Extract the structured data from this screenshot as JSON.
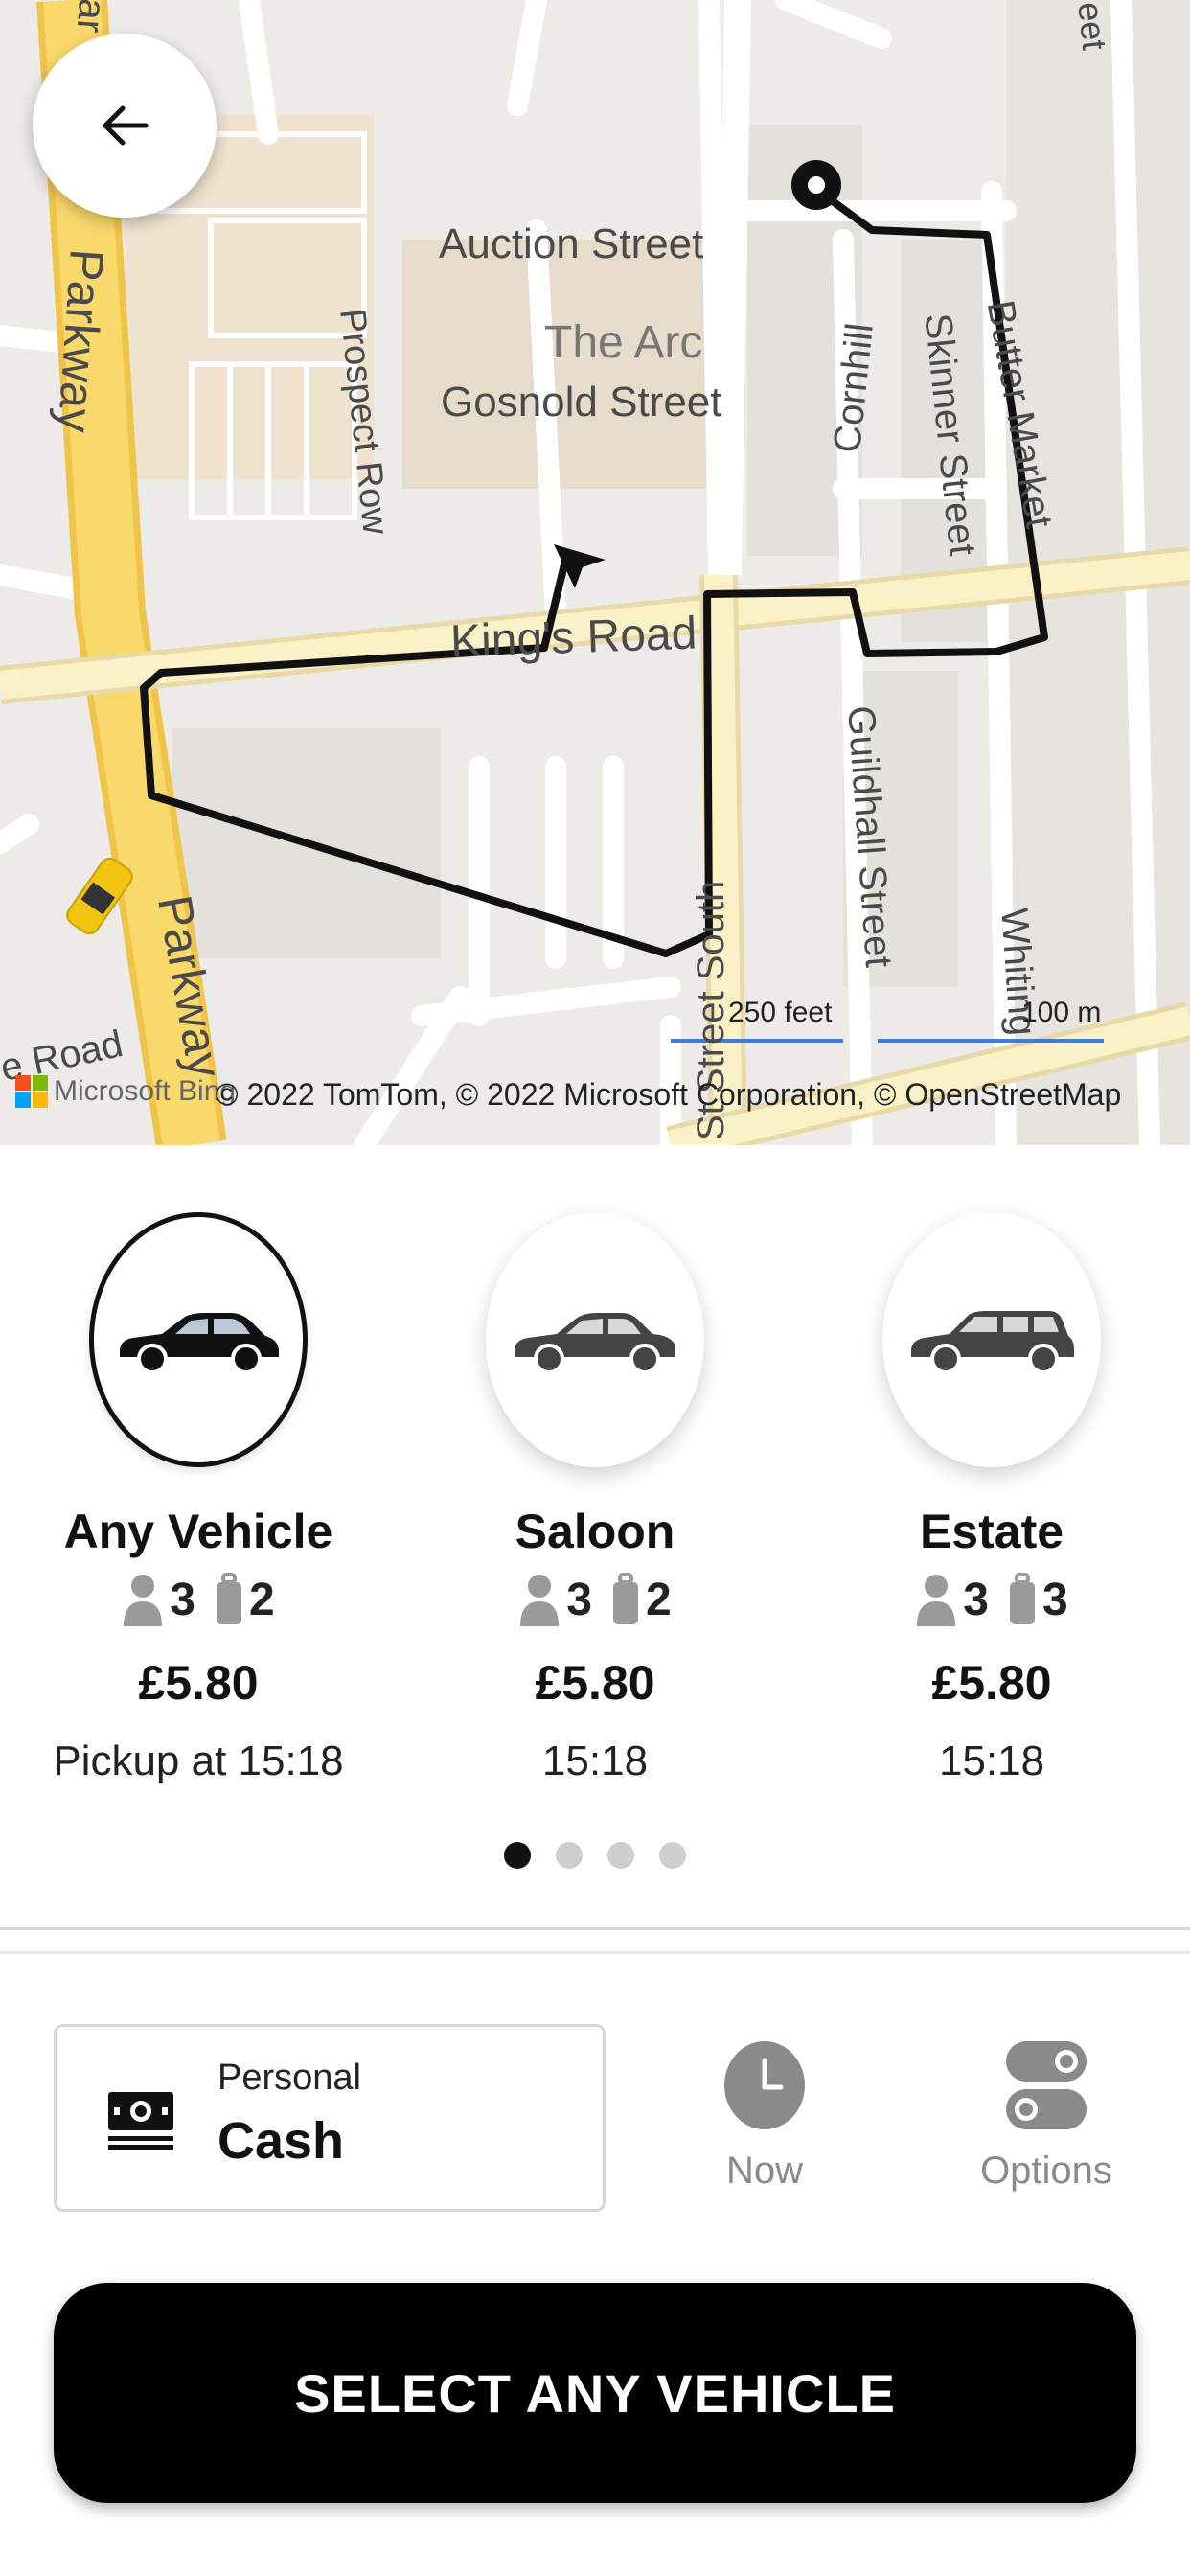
{
  "map": {
    "streets": {
      "auction": "Auction Street",
      "arc": "The Arc",
      "gosnold": "Gosnold Street",
      "prospect": "Prospect Row",
      "kings": "King's Road",
      "parkway_top": "Parkway",
      "parkway_bottom": "Parkway",
      "cornhill": "Cornhill",
      "skinner": "Skinner Street",
      "butter": "Butter Market",
      "guildhall": "Guildhall Street",
      "st_south": "St Street South",
      "whiting": "Whiting",
      "road": "e Road",
      "top_right": "eet",
      "top_left": "ar"
    },
    "scale_feet": "250 feet",
    "scale_m": "100 m",
    "copyright": "© 2022 TomTom, © 2022 Microsoft Corporation, © OpenStreetMap",
    "provider": "Microsoft Bing"
  },
  "vehicles": [
    {
      "name": "Any Vehicle",
      "passengers": "3",
      "luggage": "2",
      "price": "£5.80",
      "time": "Pickup at 15:18",
      "selected": true
    },
    {
      "name": "Saloon",
      "passengers": "3",
      "luggage": "2",
      "price": "£5.80",
      "time": "15:18",
      "selected": false
    },
    {
      "name": "Estate",
      "passengers": "3",
      "luggage": "3",
      "price": "£5.80",
      "time": "15:18",
      "selected": false
    }
  ],
  "payment": {
    "label": "Personal",
    "method": "Cash"
  },
  "actions": {
    "now": "Now",
    "options": "Options"
  },
  "cta": "SELECT ANY VEHICLE",
  "colors": {
    "primary": "#000000",
    "road_major": "#f9d96b",
    "map_bg": "#ecebe7"
  }
}
